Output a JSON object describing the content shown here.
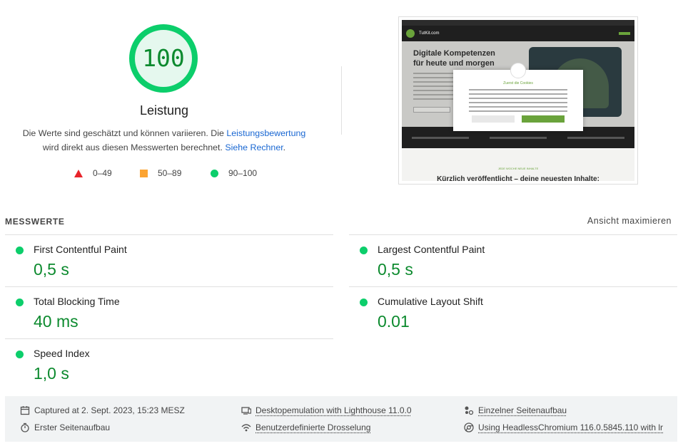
{
  "score": {
    "value": "100",
    "fraction": 1.0,
    "category": "Leistung",
    "color": "#0cce6b"
  },
  "description": {
    "prefix": "Die Werte sind geschätzt und können variieren. Die ",
    "link1": "Leistungsbewertung",
    "middle": " wird direkt aus diesen Messwerten berechnet. ",
    "link2": "Siehe Rechner",
    "suffix": "."
  },
  "legend": [
    {
      "range": "0–49",
      "shape": "triangle",
      "color": "#e8242b"
    },
    {
      "range": "50–89",
      "shape": "square",
      "color": "#fca432"
    },
    {
      "range": "90–100",
      "shape": "circle",
      "color": "#0cce6b"
    }
  ],
  "thumbnail": {
    "logo_text": "TutKit.com",
    "hero_title_1": "Digitale Kompetenzen",
    "hero_title_2": "für heute und morgen",
    "modal_title": "Zuerst die Cookies",
    "section_small": "JEDE WOCHE NEUE INHALTE",
    "section_big": "Kürzlich veröffentlicht – deine neuesten Inhalte:"
  },
  "metrics": {
    "header": "MESSWERTE",
    "toggle": "Ansicht maximieren",
    "items": [
      {
        "title": "First Contentful Paint",
        "value": "0,5 s"
      },
      {
        "title": "Largest Contentful Paint",
        "value": "0,5 s"
      },
      {
        "title": "Total Blocking Time",
        "value": "40 ms"
      },
      {
        "title": "Cumulative Layout Shift",
        "value": "0.01"
      },
      {
        "title": "Speed Index",
        "value": "1,0 s"
      }
    ]
  },
  "footer": {
    "captured": "Captured at 2. Sept. 2023, 15:23 MESZ",
    "emulation": "Desktopemulation with Lighthouse 11.0.0",
    "single_load": "Einzelner Seitenaufbau",
    "first_load": "Erster Seitenaufbau",
    "throttling": "Benutzerdefinierte Drosselung",
    "browser": "Using HeadlessChromium 116.0.5845.110 with lr"
  }
}
